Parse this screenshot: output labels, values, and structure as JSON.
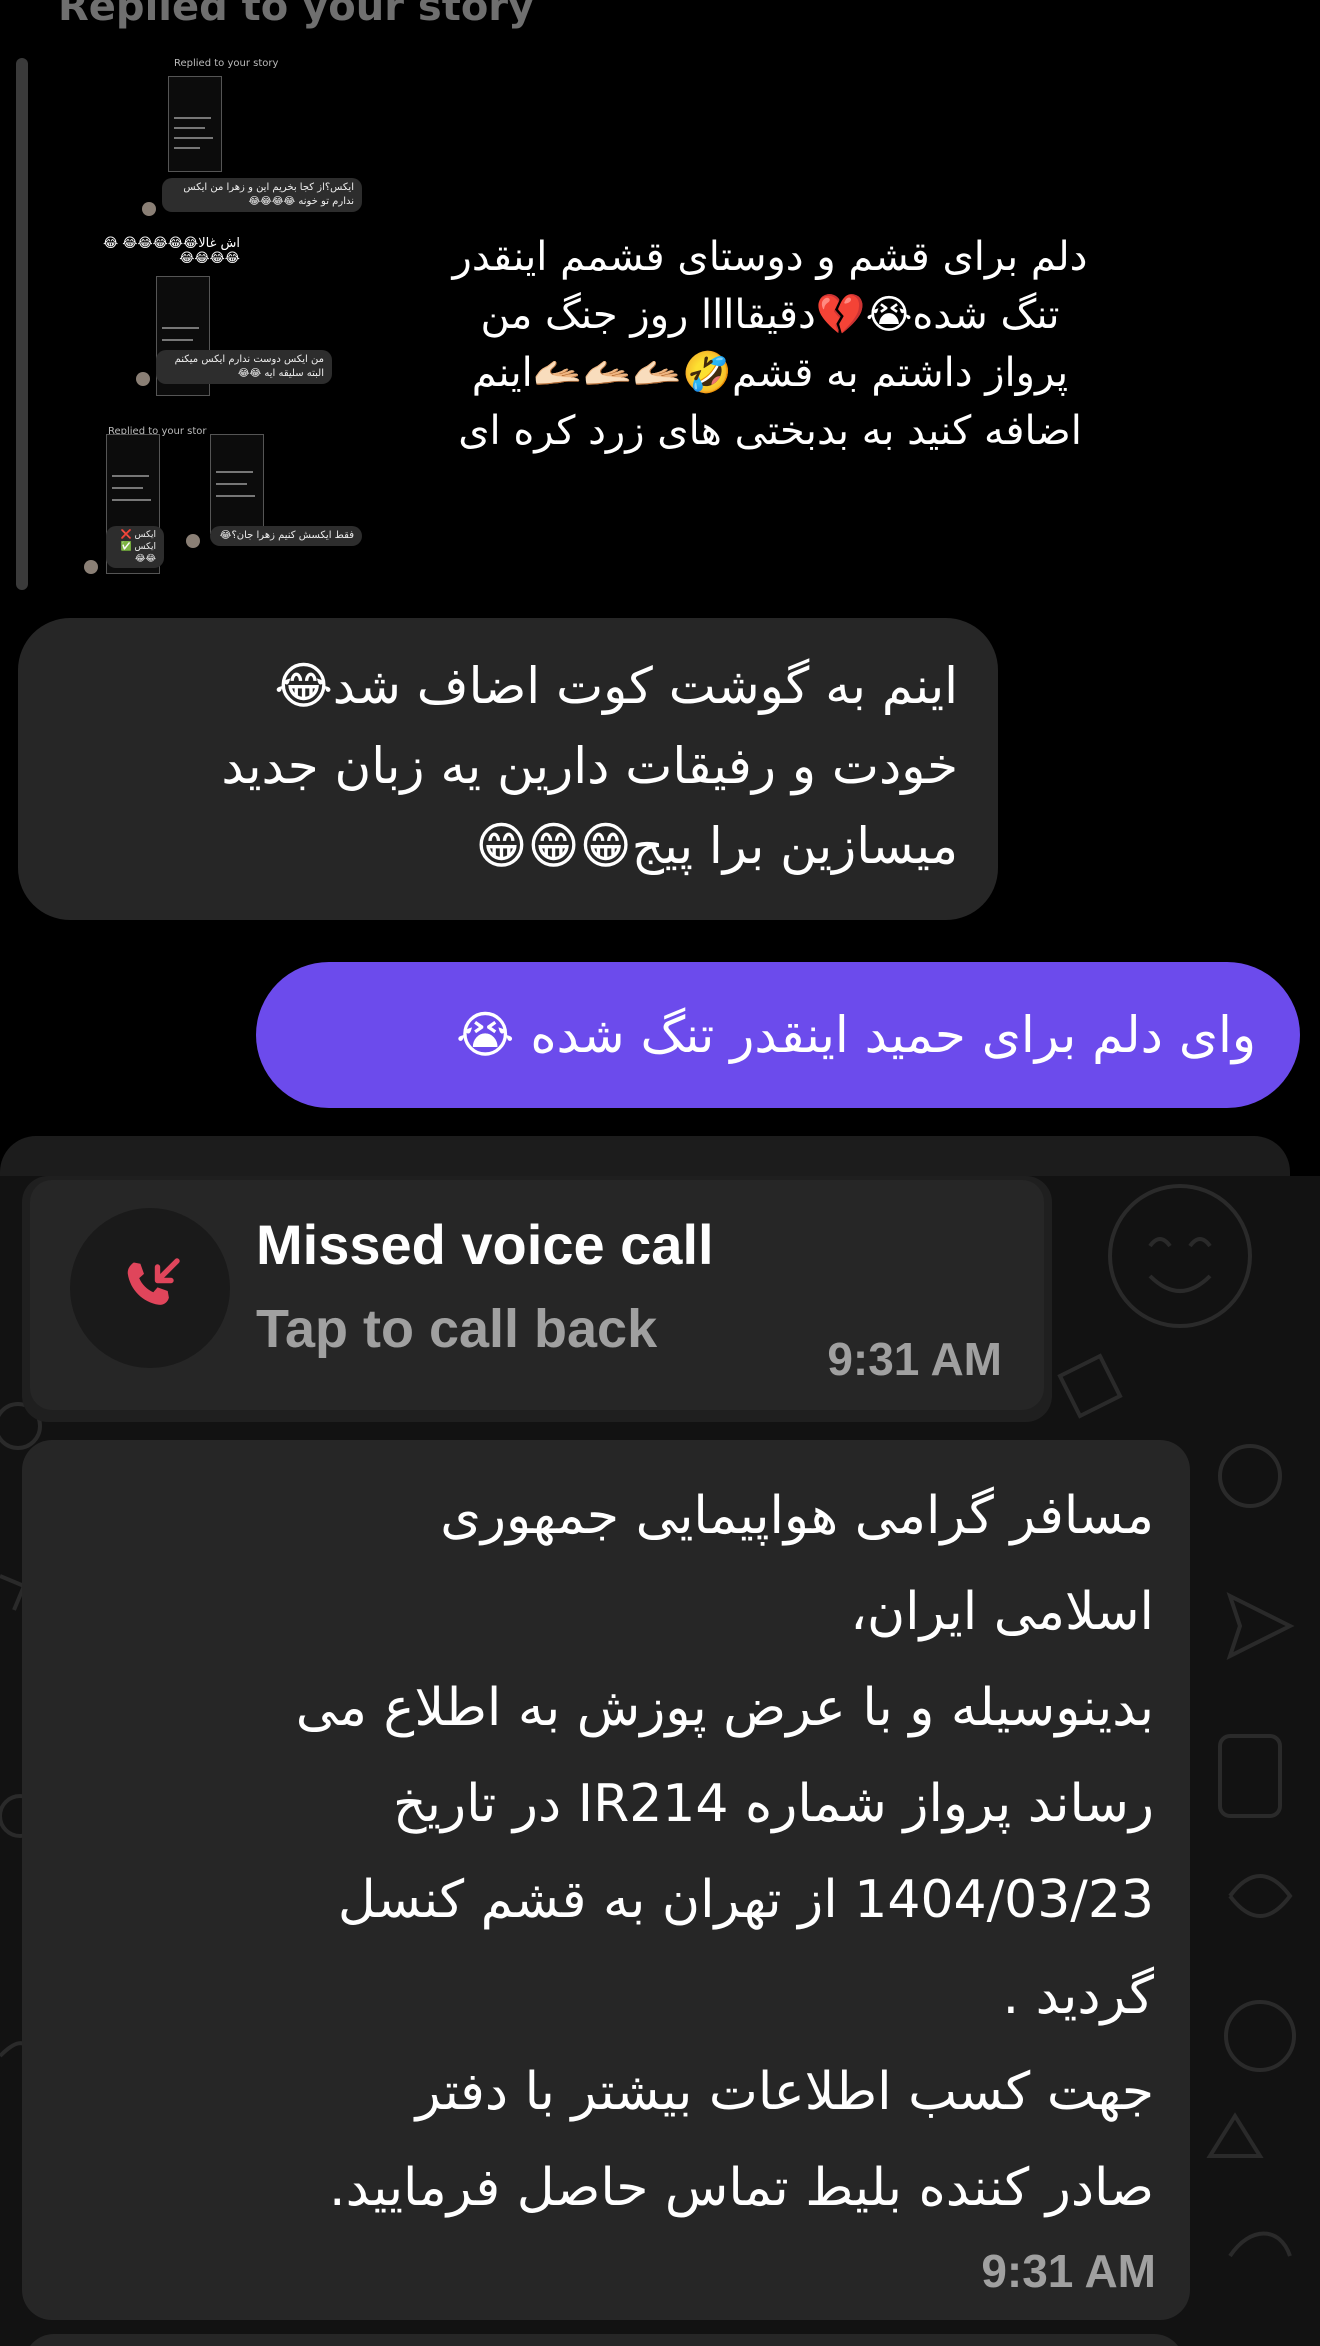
{
  "instagram": {
    "replied_label": "Replied to your story",
    "story_thumbnail": {
      "replied_label_small": "Replied to your story",
      "replied_label_small_2": "Replied to your stor",
      "bubble_1": "ایکس؟از کجا بخریم این و زهرا من ایکس ندارم تو خونه 😂😂😂😂",
      "line_ash": "اش غالا😂😂😂😂😂 😂😂😂😂😂",
      "bubble_2": "من ایکس دوست ندارم ایکس میکنم البته سلیقه ایه 😂😂",
      "bubble_3": "فقط ایکسش کنیم زهرا جان؟😂",
      "checklist": "ایکس ❌ ایکس ✅ 😂😂"
    },
    "story_reply_text": "دلم برای قشم و دوستای قشمم اینقدر تنگ شده😭💔دقیقاااا روز جنگ من پرواز داشتم به قشم🤣🫴🏻🫴🏻🫴🏻اینم اضافه کنید به بدبختی های زرد کره ای",
    "incoming_message": {
      "line1": "اینم به گوشت کوت اضاف شد😂",
      "line2": "خودت و رفیقات دارین یه زبان جدید",
      "line3": "میسازین برا پیج😁😁😁"
    },
    "outgoing_message": "وای دلم برای حمید اینقدر تنگ شده 😭"
  },
  "whatsapp": {
    "call": {
      "title": "Missed voice call",
      "subtitle": "Tap to call back",
      "time": "9:31 AM",
      "icon": "missed-call-icon",
      "icon_color": "#e0455b"
    },
    "message": {
      "lines": [
        "مسافر گرامی هواپیمایی  جمهوری",
        "اسلامی ایران،",
        " بدینوسیله و با عرض پوزش به اطلاع می",
        "رساند پرواز شماره IR214 در تاریخ",
        "1404/03/23 از تهران به قشم کنسل",
        "گردید .",
        "جهت کسب اطلاعات بیشتر با دفتر",
        "صادر کننده بلیط تماس حاصل فرمایید."
      ],
      "time": "9:31 AM"
    }
  },
  "colors": {
    "outgoing_bubble": "#6c4bec",
    "incoming_bubble": "#262626",
    "wa_background": "#121212"
  }
}
